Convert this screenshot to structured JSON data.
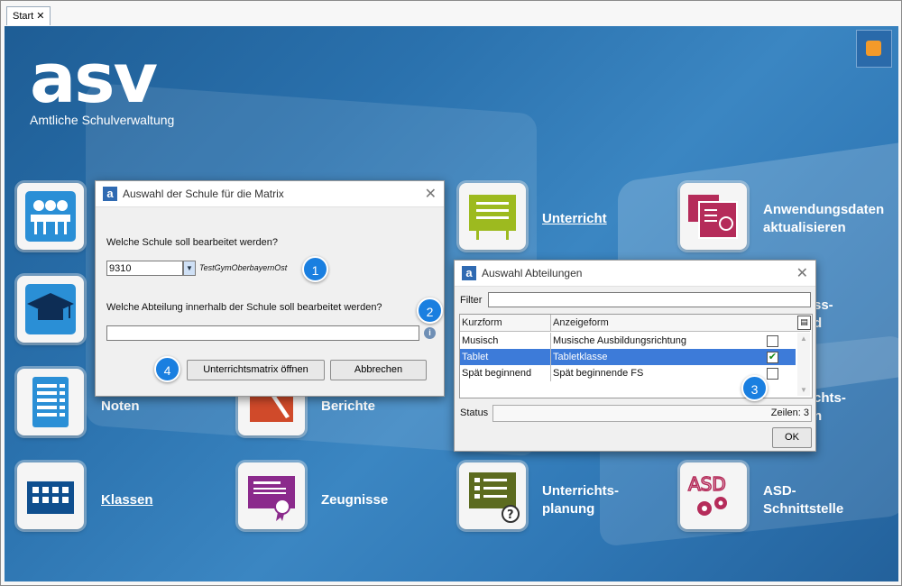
{
  "tab": {
    "label": "Start",
    "close": "✕"
  },
  "logo": {
    "text": "asv",
    "subtitle": "Amtliche Schulverwaltung"
  },
  "tiles": {
    "unterricht": "Unterricht",
    "anwendungsdaten": "Anwendungsdaten aktualisieren",
    "noten": "Noten",
    "berichte": "Berichte",
    "klassen": "Klassen",
    "zeugnisse": "Zeugnisse",
    "unterrichtsplanung": "Unterrichts-planung",
    "asd": "ASD-Schnittstelle",
    "partial1": "ss-",
    "partial1b": "d",
    "partial2": "chts-",
    "partial2b": "n"
  },
  "dialog_school": {
    "title": "Auswahl der Schule für die Matrix",
    "question1": "Welche Schule soll bearbeitet werden?",
    "school_value": "9310",
    "school_name": "TestGymOberbayernOst",
    "question2": "Welche Abteilung innerhalb der Schule soll bearbeitet werden?",
    "department_value": "",
    "open_button": "Unterrichtsmatrix öffnen",
    "cancel_button": "Abbrechen"
  },
  "dialog_dept": {
    "title": "Auswahl Abteilungen",
    "filter_label": "Filter",
    "filter_value": "",
    "col_kurzform": "Kurzform",
    "col_anzeigeform": "Anzeigeform",
    "rows": [
      {
        "kurz": "Musisch",
        "anzeige": "Musische Ausbildungsrichtung",
        "checked": false
      },
      {
        "kurz": "Tablet",
        "anzeige": "Tabletklasse",
        "checked": true
      },
      {
        "kurz": "Spät beginnend",
        "anzeige": "Spät beginnende FS",
        "checked": false
      }
    ],
    "status_label": "Status",
    "rows_count": "Zeilen: 3",
    "ok_button": "OK"
  },
  "badges": {
    "b1": "1",
    "b2": "2",
    "b3": "3",
    "b4": "4"
  },
  "colors": {
    "accent": "#1a7fe0",
    "background": "#2a71ad",
    "selection": "#3d7bd9"
  }
}
